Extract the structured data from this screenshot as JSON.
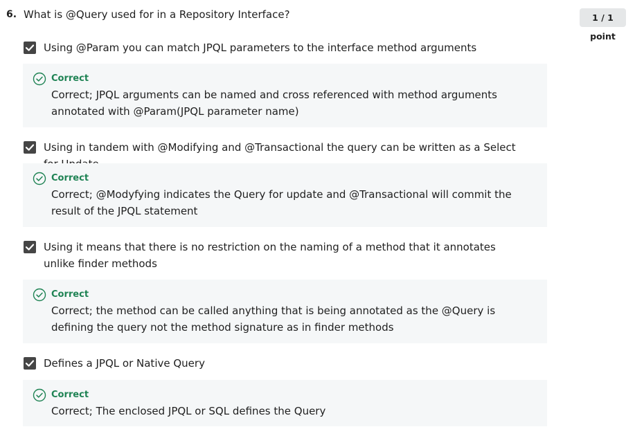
{
  "question": {
    "number": "6.",
    "text": "What is @Query used for in a Repository Interface?",
    "points": "1 / 1 point"
  },
  "options": [
    {
      "text": "Using @Param you can match JPQL parameters to the interface method arguments",
      "checked": true,
      "feedback_label": "Correct",
      "feedback_text": "Correct; JPQL arguments can be named and cross referenced with method arguments annotated with @Param(JPQL parameter name)"
    },
    {
      "text": "Using in tandem with @Modifying and @Transactional the query can be written as a Select for Update",
      "checked": true,
      "feedback_label": "Correct",
      "feedback_text": "Correct; @Modyfying indicates the Query for update and @Transactional will commit the result of the JPQL statement"
    },
    {
      "text": "Using it means that there is no restriction on the naming of a method that it annotates unlike finder methods",
      "checked": true,
      "feedback_label": "Correct",
      "feedback_text": "Correct; the method can be called anything that is being annotated as the @Query is defining the query not the method signature as in finder methods"
    },
    {
      "text": "Defines a JPQL or Native Query",
      "checked": true,
      "feedback_label": "Correct",
      "feedback_text": "Correct; The enclosed JPQL or SQL defines the Query"
    }
  ],
  "icons": {
    "checkbox": "checkbox-checked-icon",
    "feedback": "check-circle-icon"
  },
  "colors": {
    "checkbox_fill": "#454545",
    "correct_green": "#1f8354",
    "feedback_bg": "#f5f7f8",
    "points_bg": "#e5e7e8"
  }
}
